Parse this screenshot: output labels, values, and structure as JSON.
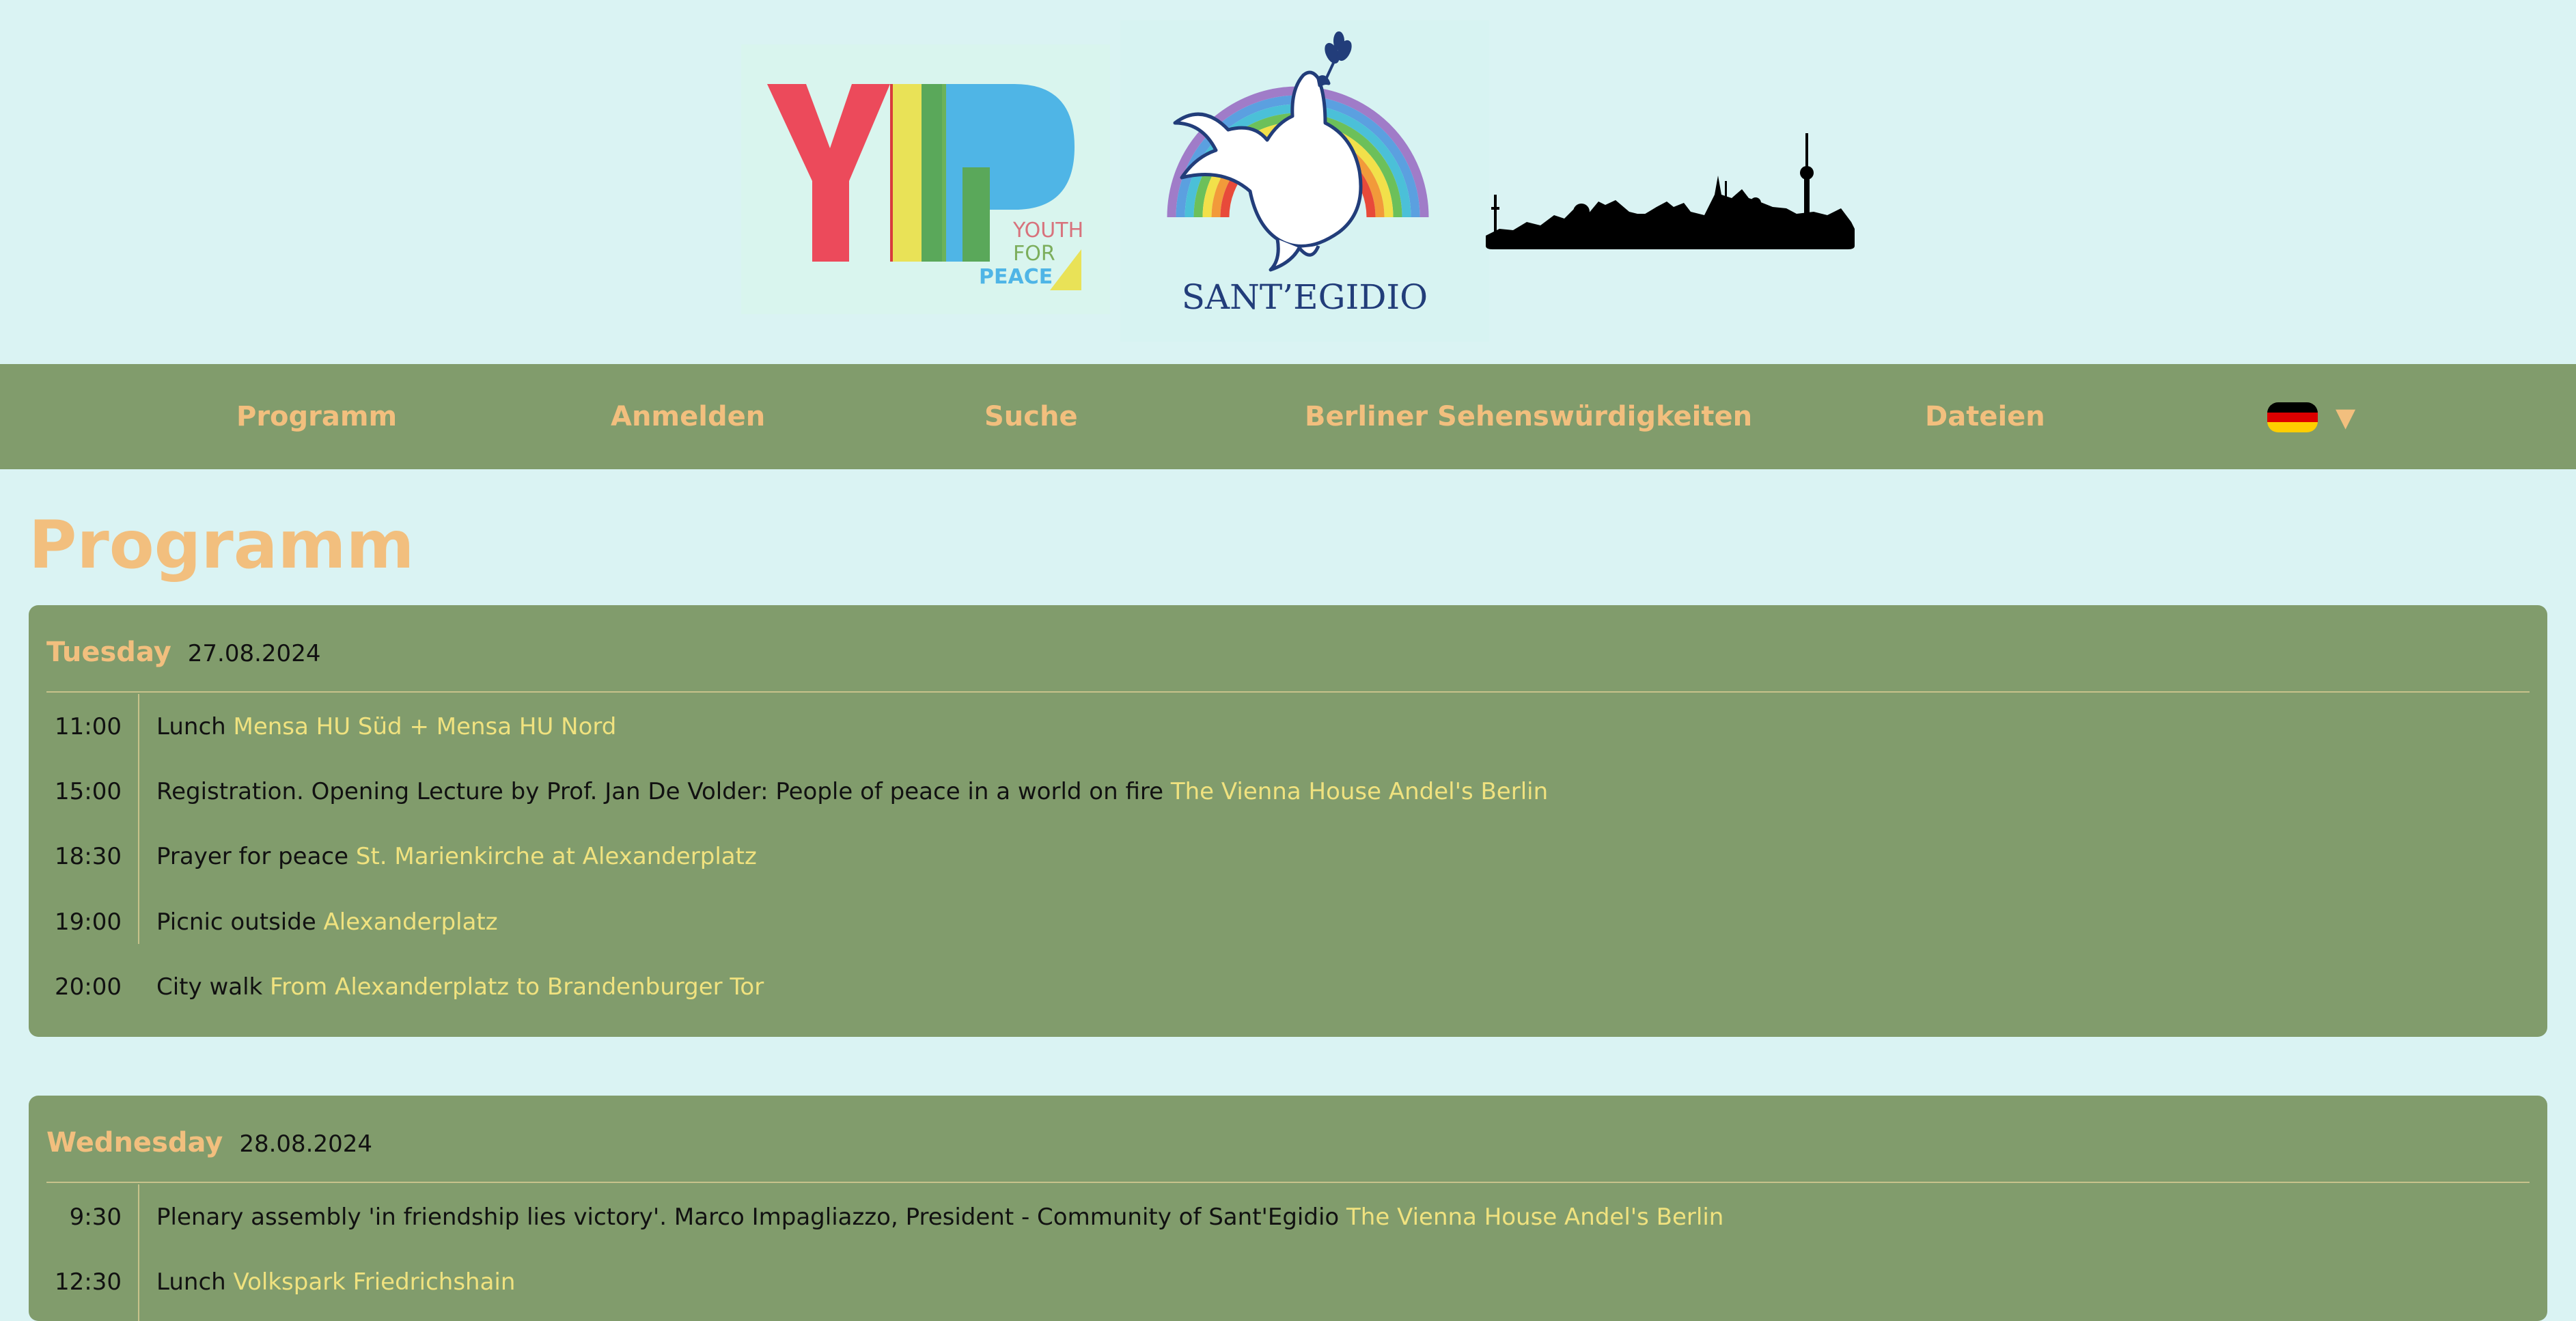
{
  "colors": {
    "page_bg": "#daf3f3",
    "panel_bg": "#819c6c",
    "accent_orange": "#f2bf7e",
    "location_yellow": "#f0e27f"
  },
  "header": {
    "yfp_logo": {
      "icon": "youth-for-peace-logo",
      "lines": [
        "YOUTH",
        "FOR",
        "PEACE"
      ]
    },
    "santegidio_logo": {
      "icon": "dove-rainbow-logo",
      "text": "SANT’EGIDIO"
    },
    "skyline": {
      "icon": "berlin-skyline"
    }
  },
  "nav": {
    "items": [
      {
        "label": "Programm"
      },
      {
        "label": "Anmelden"
      },
      {
        "label": "Suche"
      },
      {
        "label": "Berliner Sehenswürdigkeiten"
      },
      {
        "label": "Dateien"
      }
    ],
    "language": {
      "icon": "german-flag-icon",
      "caret": "▼"
    }
  },
  "page": {
    "title": "Programm"
  },
  "days": [
    {
      "name": "Tuesday",
      "date": "27.08.2024",
      "events": [
        {
          "time": "11:00",
          "text": "Lunch",
          "location": "Mensa HU Süd + Mensa HU Nord"
        },
        {
          "time": "15:00",
          "text": "Registration. Opening Lecture by Prof. Jan De Volder: People of peace in a world on fire",
          "location": "The Vienna House Andel's Berlin"
        },
        {
          "time": "18:30",
          "text": "Prayer for peace",
          "location": "St. Marienkirche at Alexanderplatz"
        },
        {
          "time": "19:00",
          "text": "Picnic outside",
          "location": "Alexanderplatz"
        },
        {
          "time": "20:00",
          "text": "City walk",
          "location": "From Alexanderplatz to Brandenburger Tor"
        }
      ]
    },
    {
      "name": "Wednesday",
      "date": "28.08.2024",
      "events": [
        {
          "time": "9:30",
          "text": "Plenary assembly 'in friendship lies victory'. Marco Impagliazzo, President - Community of Sant'Egidio",
          "location": "The Vienna House Andel's Berlin"
        },
        {
          "time": "12:30",
          "text": "Lunch",
          "location": "Volkspark Friedrichshain"
        }
      ]
    }
  ]
}
